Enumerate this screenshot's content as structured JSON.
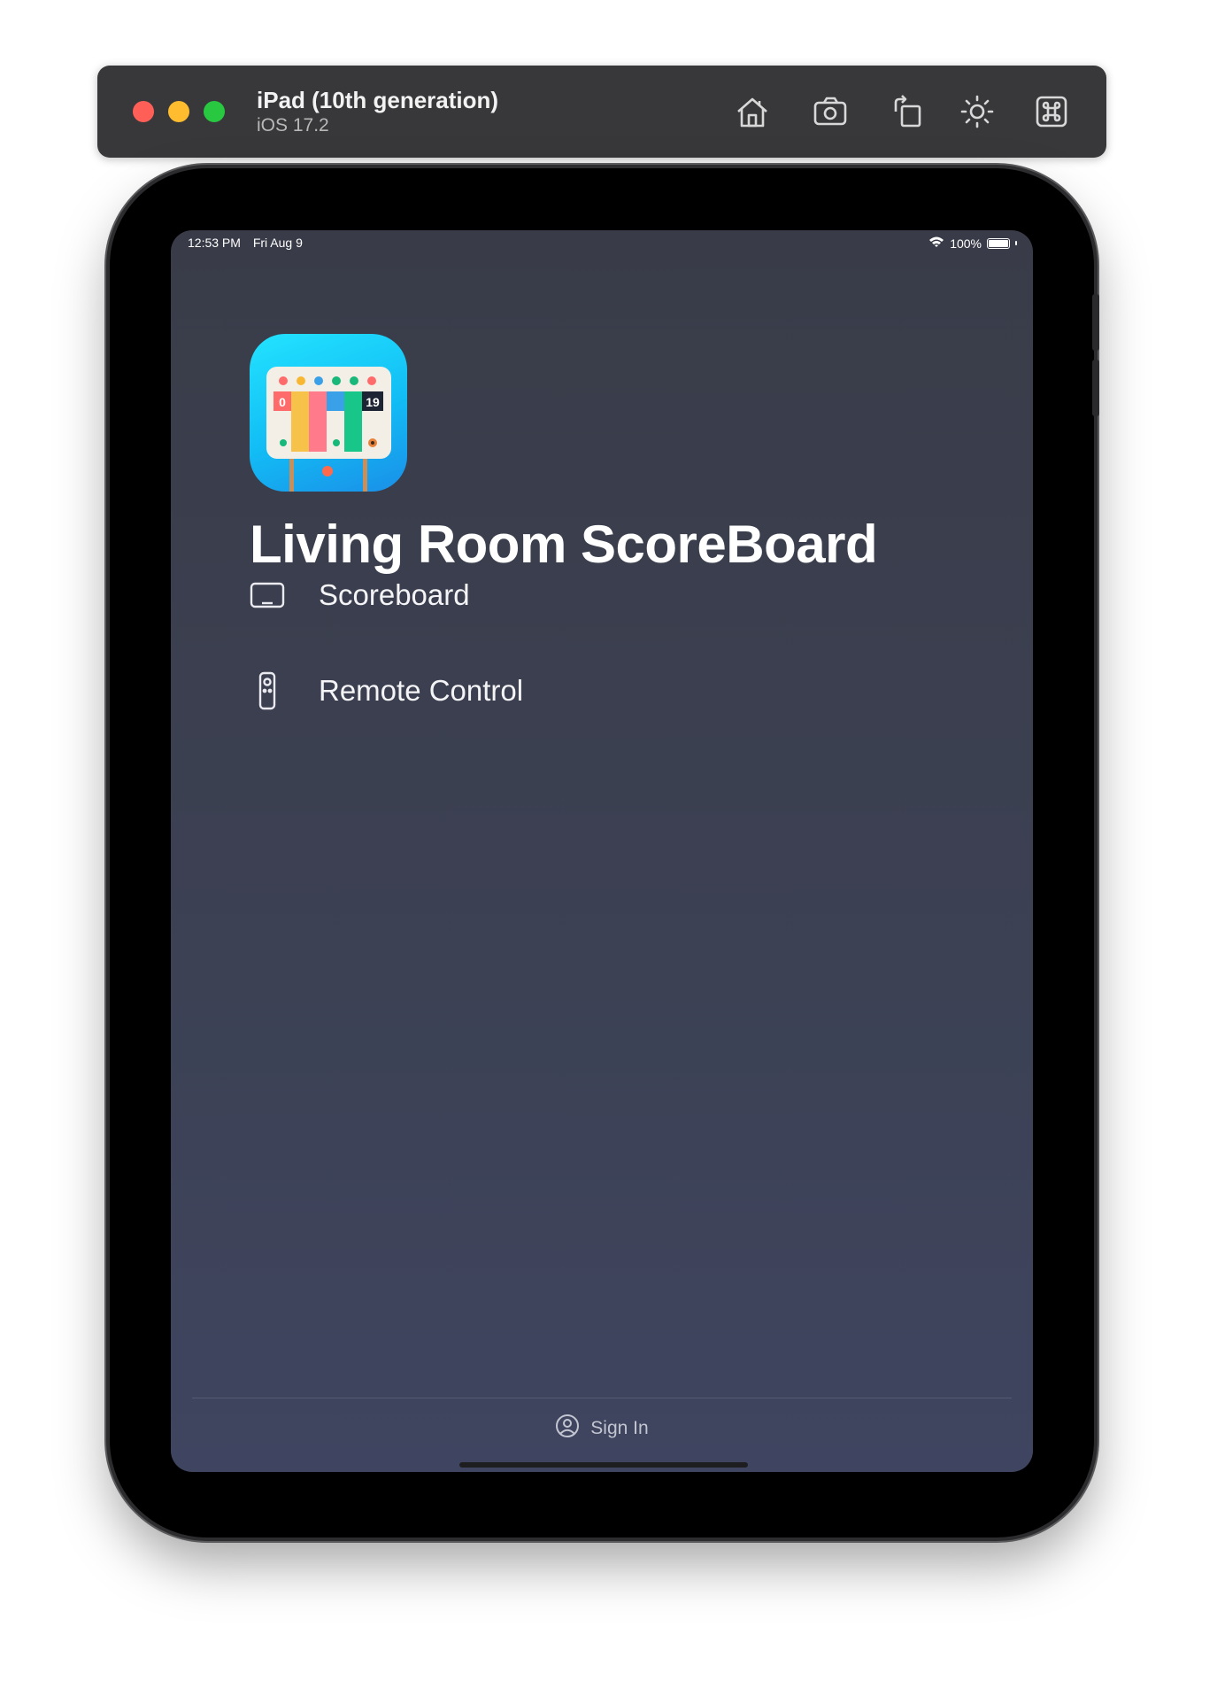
{
  "simulator": {
    "device_name": "iPad (10th generation)",
    "os_version": "iOS 17.2",
    "toolbar_icons": [
      "home-icon",
      "screenshot-icon",
      "rotate-icon",
      "appearance-icon",
      "command-icon"
    ]
  },
  "status_bar": {
    "time": "12:53 PM",
    "date": "Fri Aug 9",
    "battery": "100%"
  },
  "app": {
    "title": "Living Room ScoreBoard",
    "icon_scores": {
      "left": "0",
      "right": "19"
    },
    "menu": [
      {
        "label": "Scoreboard",
        "icon": "tv-icon"
      },
      {
        "label": "Remote Control",
        "icon": "remote-icon"
      }
    ],
    "sign_in_label": "Sign In"
  },
  "colors": {
    "screen_background": "#3b3f50",
    "text": "#ffffff",
    "sign_in_text": "#c3c6d0"
  }
}
